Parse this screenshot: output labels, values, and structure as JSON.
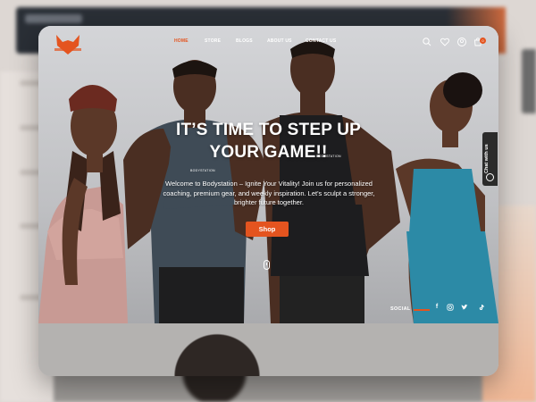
{
  "header": {
    "logo": "logo-fox-icon",
    "nav": [
      {
        "label": "HOME",
        "active": true
      },
      {
        "label": "STORE",
        "active": false
      },
      {
        "label": "BLOGS",
        "active": false
      },
      {
        "label": "ABOUT US",
        "active": false
      },
      {
        "label": "CONTACT US",
        "active": false
      }
    ],
    "icons": [
      "search-icon",
      "heart-icon",
      "user-icon",
      "cart-icon"
    ],
    "cart_count": "0"
  },
  "hero": {
    "headline_line1": "IT’S TIME TO STEP UP",
    "headline_line2": "YOUR GAME!!",
    "shirt_tag_left": "BODYSTATION",
    "shirt_tag_right": "BODYSTATION",
    "subtext": "Welcome to Bodystation – Ignite Your Vitality! Join us for personalized coaching, premium gear, and weekly inspiration. Let's sculpt a stronger, brighter future together.",
    "cta": "Shop"
  },
  "social": {
    "label": "SOCIAL",
    "icons": [
      "facebook-icon",
      "instagram-icon",
      "twitter-icon",
      "tiktok-icon"
    ]
  },
  "chat": {
    "label": "Chat with us"
  },
  "colors": {
    "accent": "#e4541f",
    "dark": "#2b2b2b"
  }
}
